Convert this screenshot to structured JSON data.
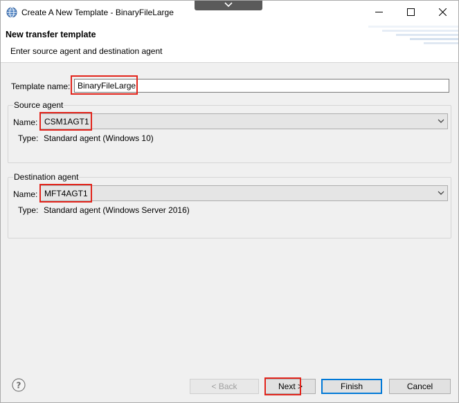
{
  "window": {
    "title": "Create A New Template - BinaryFileLarge"
  },
  "banner": {
    "title": "New transfer template",
    "description": "Enter source agent and destination agent"
  },
  "template": {
    "label": "Template name:",
    "value": "BinaryFileLarge"
  },
  "source": {
    "group_title": "Source agent",
    "name_label": "Name:",
    "name_value": "CSM1AGT1",
    "type_label": "Type:",
    "type_value": "Standard agent (Windows 10)"
  },
  "destination": {
    "group_title": "Destination agent",
    "name_label": "Name:",
    "name_value": "MFT4AGT1",
    "type_label": "Type:",
    "type_value": "Standard agent (Windows Server 2016)"
  },
  "buttons": {
    "back": "< Back",
    "next": "Next >",
    "finish": "Finish",
    "cancel": "Cancel"
  },
  "colors": {
    "highlight": "#e2231a",
    "default_button": "#0078d7"
  },
  "icons": [
    "app-globe-icon",
    "chevron-down-icon",
    "minimize-icon",
    "maximize-icon",
    "close-icon",
    "help-icon"
  ]
}
